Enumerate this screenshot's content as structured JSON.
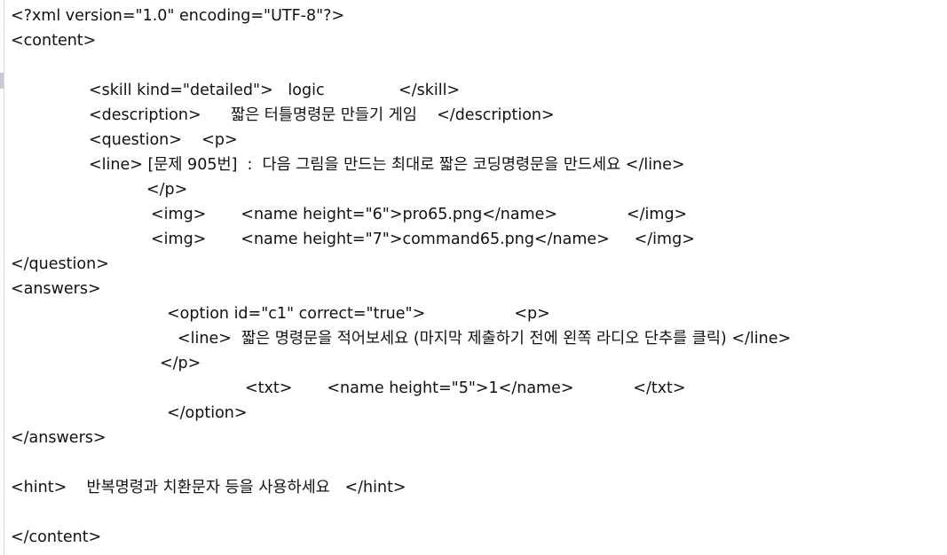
{
  "document": {
    "lines": [
      "<?xml version=\"1.0\" encoding=\"UTF-8\"?>",
      "<content>",
      "",
      "<skill kind=\"detailed\">   logic               </skill>",
      "<description>      짧은 터틀명령문 만들기 게임    </description>",
      "<question>    <p>",
      "<line> [문제 905번]  :  다음 그림을 만드는 최대로 짧은 코딩명령문을 만드세요 </line>",
      "</p>",
      "<img>       <name height=\"6\">pro65.png</name>              </img>",
      "<img>       <name height=\"7\">command65.png</name>     </img>",
      "</question>",
      "<answers>",
      "<option id=\"c1\" correct=\"true\">                  <p>",
      "<line>  짧은 명령문을 적어보세요 (마지막 제출하기 전에 왼쪽 라디오 단추를 클릭) </line>",
      "</p>",
      "<txt>       <name height=\"5\">1</name>            </txt>",
      "</option>",
      "</answers>",
      "",
      "<hint>    반복명령과 치환문자 등을 사용하세요   </hint>",
      "",
      "</content>"
    ]
  }
}
